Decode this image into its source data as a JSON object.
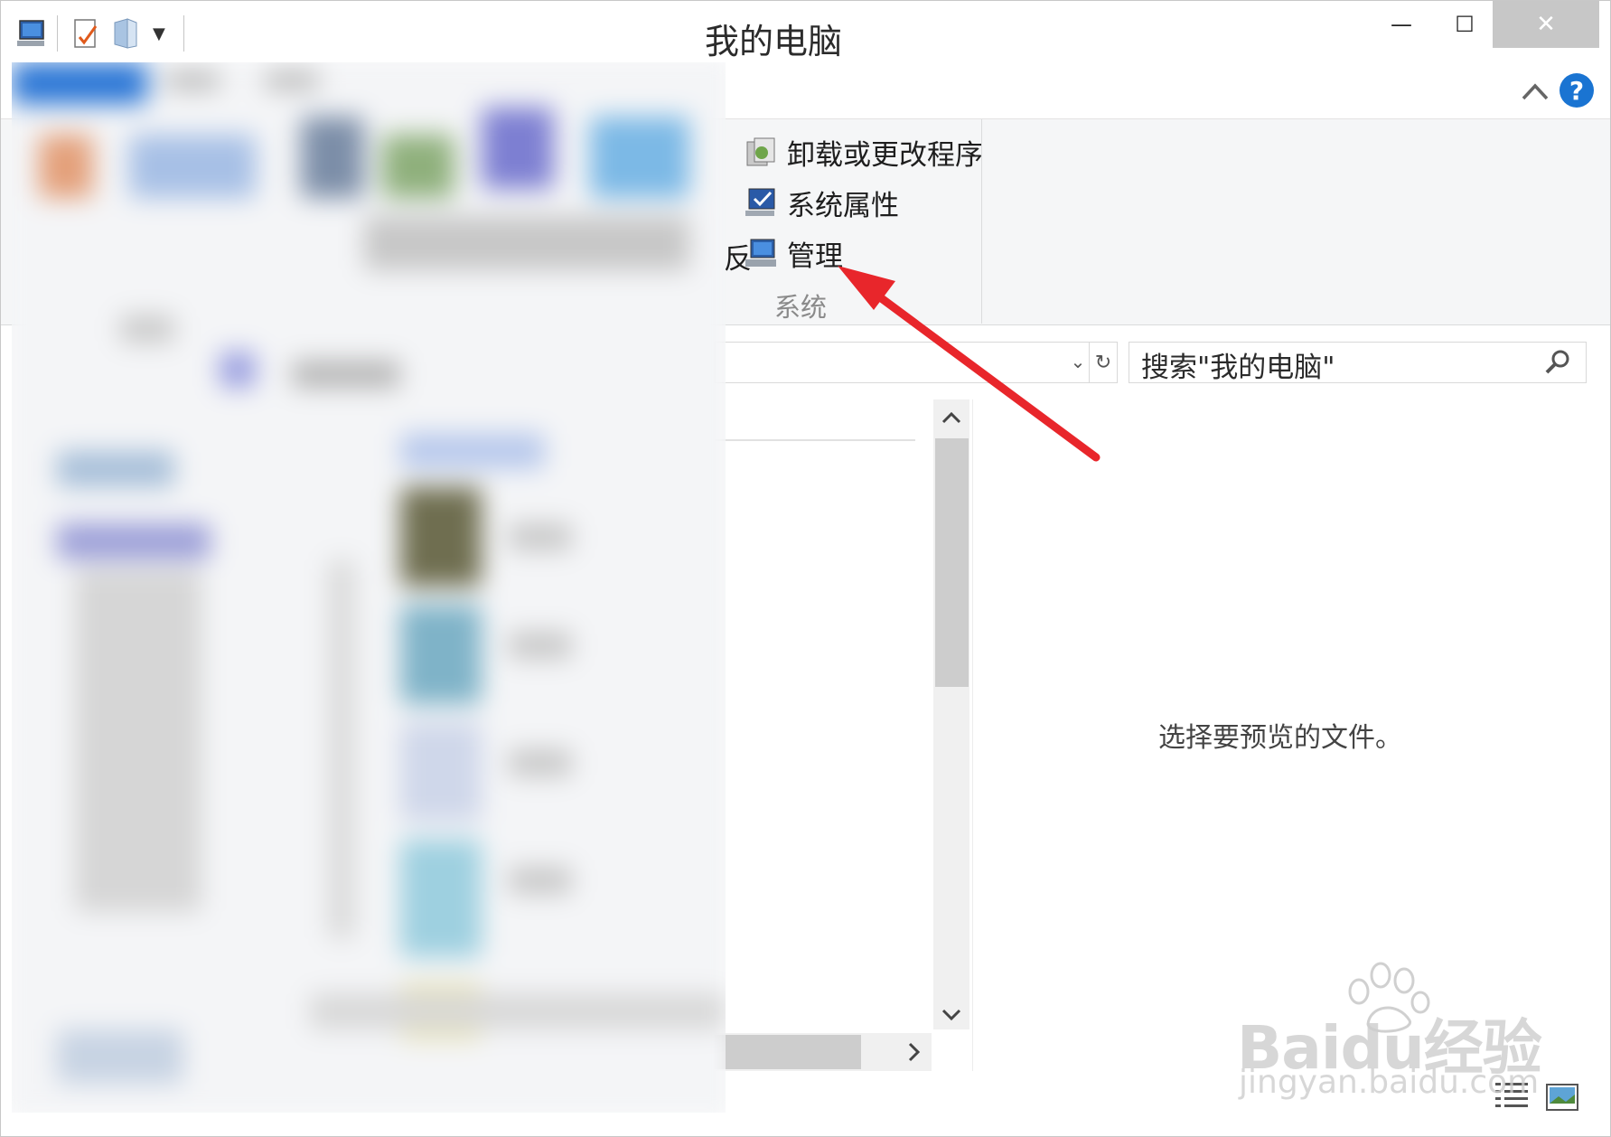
{
  "window": {
    "title": "我的电脑",
    "minimize_glyph": "—",
    "maximize_glyph": "☐",
    "close_glyph": "✕"
  },
  "quick_access": {
    "icons": [
      "computer-icon",
      "properties-icon",
      "new-folder-icon",
      "customize-dropdown-icon"
    ]
  },
  "ribbon": {
    "help_glyph": "?",
    "clipped_text": "反",
    "group_system": {
      "label": "系统",
      "items": [
        {
          "label": "卸载或更改程序",
          "icon": "uninstall-programs-icon"
        },
        {
          "label": "系统属性",
          "icon": "system-properties-icon"
        },
        {
          "label": "管理",
          "icon": "computer-management-icon"
        }
      ]
    }
  },
  "address_bar": {
    "dropdown_glyph": "⌄",
    "refresh_glyph": "↻"
  },
  "search": {
    "placeholder": "搜索\"我的电脑\"",
    "icon": "search-icon"
  },
  "preview_pane": {
    "message": "选择要预览的文件。"
  },
  "watermark": {
    "logo_text": "Baidu经验",
    "url_text": "jingyan.baidu.com"
  },
  "colors": {
    "annotation_arrow": "#e8262b",
    "accent_blue": "#1a74d2",
    "ribbon_bg": "#f5f6f7"
  }
}
